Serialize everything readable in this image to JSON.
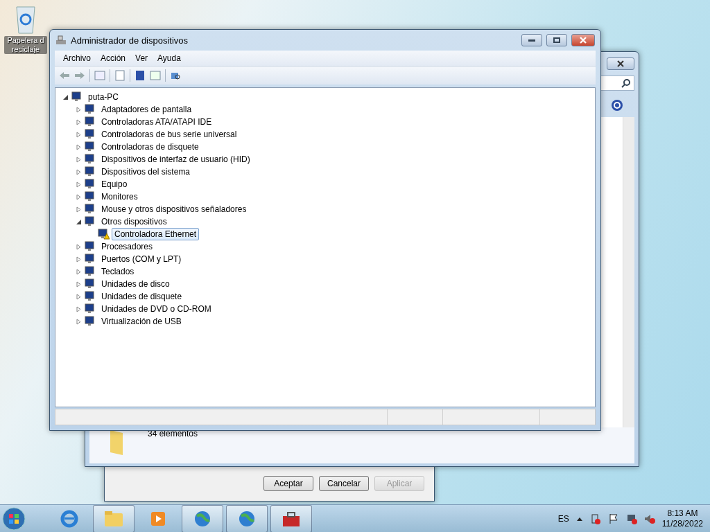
{
  "desktop_icons": [
    {
      "label": "Papelera d reciclaje"
    }
  ],
  "back_window": {
    "status_text": "34 elementos"
  },
  "dialog": {
    "buttons": [
      {
        "label": "Aceptar",
        "disabled": false
      },
      {
        "label": "Cancelar",
        "disabled": false
      },
      {
        "label": "Aplicar",
        "disabled": true
      }
    ]
  },
  "window": {
    "title": "Administrador de dispositivos"
  },
  "menu": [
    "Archivo",
    "Acción",
    "Ver",
    "Ayuda"
  ],
  "tree": {
    "label": "puta-PC",
    "expanded": true,
    "selected": false,
    "warning": false,
    "children": [
      {
        "label": "Adaptadores de pantalla",
        "expanded": false,
        "selected": false,
        "warning": false
      },
      {
        "label": "Controladoras ATA/ATAPI IDE",
        "expanded": false,
        "selected": false,
        "warning": false
      },
      {
        "label": "Controladoras de bus serie universal",
        "expanded": false,
        "selected": false,
        "warning": false
      },
      {
        "label": "Controladoras de disquete",
        "expanded": false,
        "selected": false,
        "warning": false
      },
      {
        "label": "Dispositivos de interfaz de usuario (HID)",
        "expanded": false,
        "selected": false,
        "warning": false
      },
      {
        "label": "Dispositivos del sistema",
        "expanded": false,
        "selected": false,
        "warning": false
      },
      {
        "label": "Equipo",
        "expanded": false,
        "selected": false,
        "warning": false
      },
      {
        "label": "Monitores",
        "expanded": false,
        "selected": false,
        "warning": false
      },
      {
        "label": "Mouse y otros dispositivos señaladores",
        "expanded": false,
        "selected": false,
        "warning": false
      },
      {
        "label": "Otros dispositivos",
        "expanded": true,
        "selected": false,
        "warning": false,
        "children": [
          {
            "label": "Controladora Ethernet",
            "selected": true,
            "warning": true
          }
        ]
      },
      {
        "label": "Procesadores",
        "expanded": false,
        "selected": false,
        "warning": false
      },
      {
        "label": "Puertos (COM y LPT)",
        "expanded": false,
        "selected": false,
        "warning": false
      },
      {
        "label": "Teclados",
        "expanded": false,
        "selected": false,
        "warning": false
      },
      {
        "label": "Unidades de disco",
        "expanded": false,
        "selected": false,
        "warning": false
      },
      {
        "label": "Unidades de disquete",
        "expanded": false,
        "selected": false,
        "warning": false
      },
      {
        "label": "Unidades de DVD o CD-ROM",
        "expanded": false,
        "selected": false,
        "warning": false
      },
      {
        "label": "Virtualización de USB",
        "expanded": false,
        "selected": false,
        "warning": false
      }
    ]
  },
  "taskbar": {
    "apps": [
      {
        "kind": "browser",
        "running": false
      },
      {
        "kind": "folder",
        "running": true
      },
      {
        "kind": "media",
        "running": false
      },
      {
        "kind": "globe",
        "running": true
      },
      {
        "kind": "globe",
        "running": true
      },
      {
        "kind": "toolbox",
        "running": true
      }
    ],
    "language": "ES",
    "time": "8:13 AM",
    "date": "11/28/2022"
  }
}
